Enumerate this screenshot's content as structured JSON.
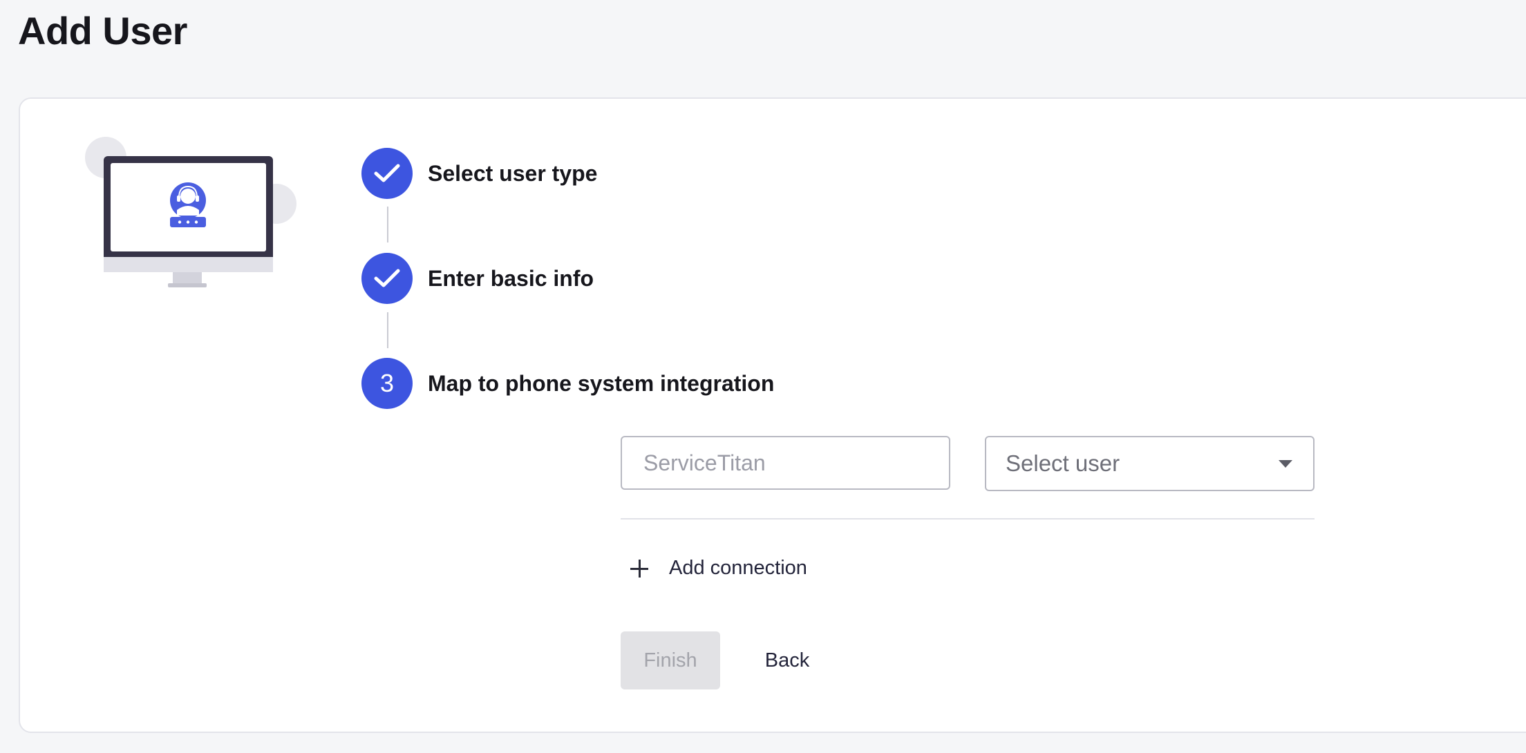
{
  "page": {
    "title": "Add User"
  },
  "steps": [
    {
      "status": "completed",
      "label": "Select user type",
      "icon": "check-icon"
    },
    {
      "status": "completed",
      "label": "Enter basic info",
      "icon": "check-icon"
    },
    {
      "status": "current",
      "number": "3",
      "label": "Map to phone system integration"
    }
  ],
  "form": {
    "integration_input": {
      "value": "",
      "placeholder": "ServiceTitan"
    },
    "user_select": {
      "selected": "Select user",
      "icon": "chevron-down-icon"
    },
    "add_connection_label": "Add connection",
    "add_connection_icon": "plus-icon",
    "finish_label": "Finish",
    "back_label": "Back"
  },
  "colors": {
    "accent": "#3d55e0",
    "page_background": "#f5f6f8",
    "card_background": "#ffffff",
    "disabled_button": "#e2e2e5",
    "illustration_frame": "#363347"
  }
}
